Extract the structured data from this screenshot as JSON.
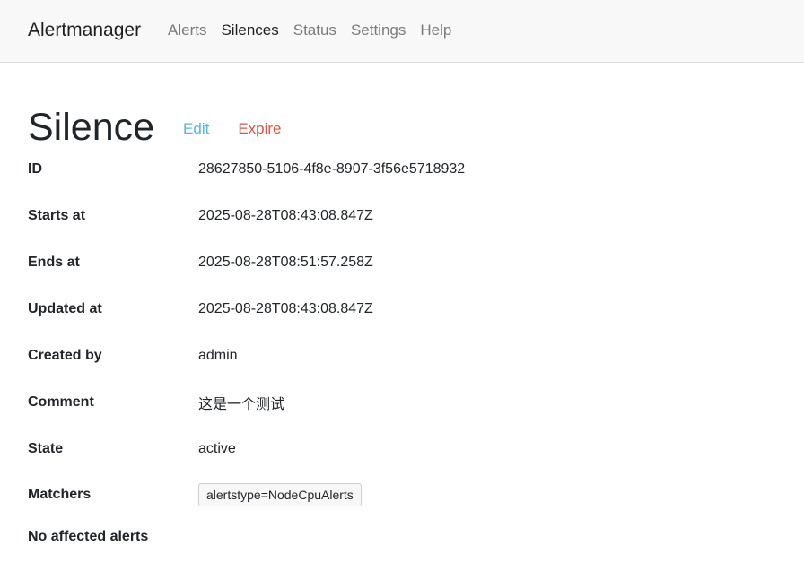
{
  "nav": {
    "brand": "Alertmanager",
    "links": [
      "Alerts",
      "Silences",
      "Status",
      "Settings",
      "Help"
    ],
    "active": "Silences"
  },
  "silence": {
    "title": "Silence",
    "edit_label": "Edit",
    "expire_label": "Expire",
    "details": [
      {
        "label": "ID",
        "value": "28627850-5106-4f8e-8907-3f56e5718932"
      },
      {
        "label": "Starts at",
        "value": "2025-08-28T08:43:08.847Z"
      },
      {
        "label": "Ends at",
        "value": "2025-08-28T08:51:57.258Z"
      },
      {
        "label": "Updated at",
        "value": "2025-08-28T08:43:08.847Z"
      },
      {
        "label": "Created by",
        "value": "admin"
      },
      {
        "label": "Comment",
        "value": "这是一个测试"
      },
      {
        "label": "State",
        "value": "active"
      }
    ],
    "matchers_label": "Matchers",
    "matchers": [
      "alertstype=NodeCpuAlerts"
    ],
    "no_affected_alerts": "No affected alerts"
  },
  "colors": {
    "navbar_bg": "#f8f8f8",
    "edit_link": "#5bb3d9",
    "expire_link": "#d9534f",
    "inactive_nav": "#7a7a7a"
  }
}
